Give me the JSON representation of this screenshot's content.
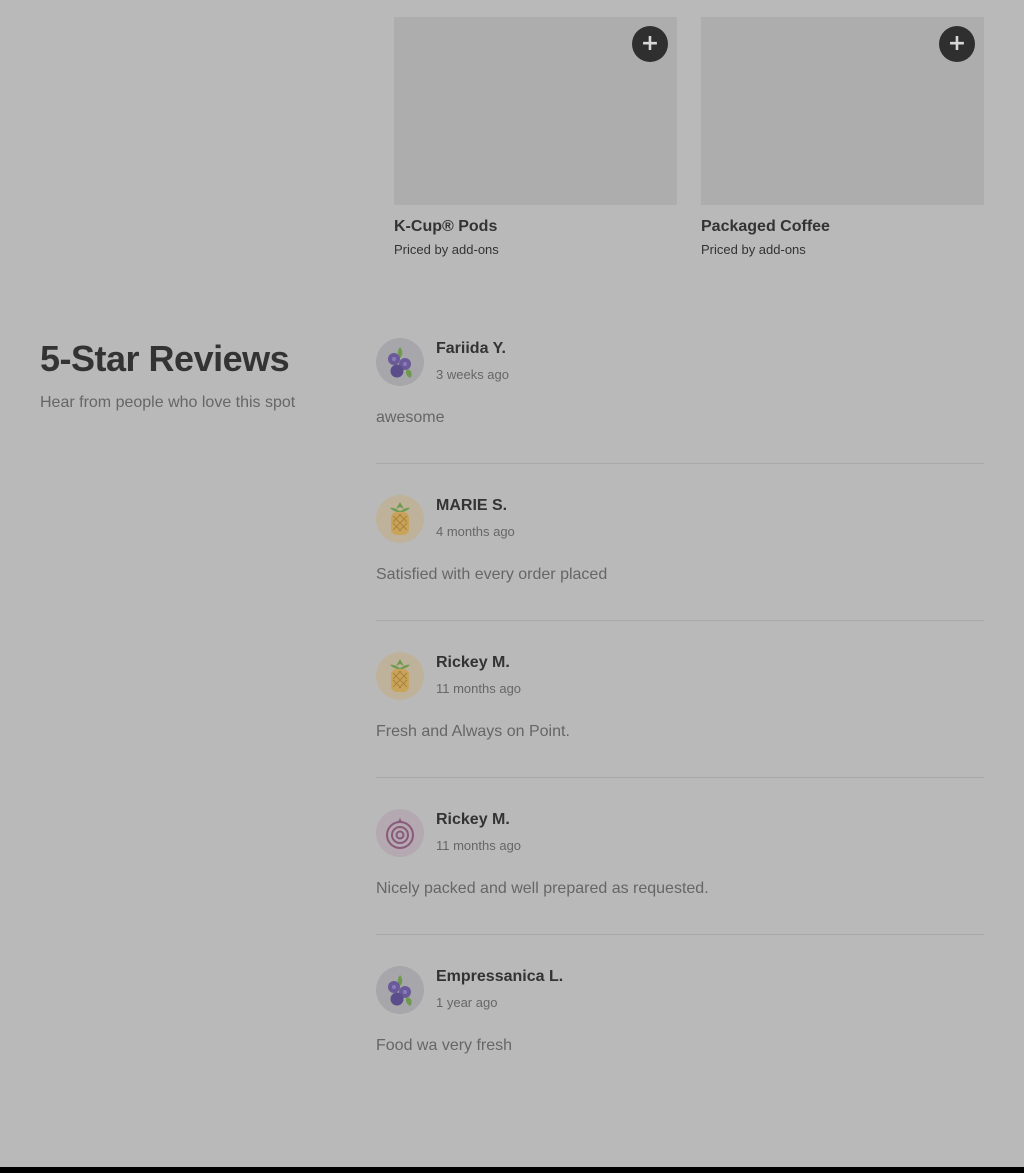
{
  "products": [
    {
      "name": "K-Cup® Pods",
      "price": "Priced by add-ons",
      "add_icon": "plus-icon"
    },
    {
      "name": "Packaged Coffee",
      "price": "Priced by add-ons",
      "add_icon": "plus-icon"
    }
  ],
  "reviews_section": {
    "title": "5-Star Reviews",
    "subtitle": "Hear from people who love this spot"
  },
  "reviews": [
    {
      "name": "Fariida Y.",
      "time": "3 weeks ago",
      "text": "awesome",
      "avatar": "blueberry-icon"
    },
    {
      "name": "MARIE S.",
      "time": "4 months ago",
      "text": "Satisfied with every order placed",
      "avatar": "pineapple-icon"
    },
    {
      "name": "Rickey M.",
      "time": "11 months ago",
      "text": "Fresh and Always on Point.",
      "avatar": "pineapple-icon"
    },
    {
      "name": "Rickey M.",
      "time": "11 months ago",
      "text": "Nicely packed and well prepared as requested.",
      "avatar": "onion-icon"
    },
    {
      "name": "Empressanica L.",
      "time": "1 year ago",
      "text": "Food wa very fresh",
      "avatar": "blueberry-icon"
    }
  ],
  "colors": {
    "overlay_background": "#b9b9b9",
    "add_button": "#2f2f2f",
    "text_primary": "#333333",
    "text_secondary": "#666666"
  }
}
